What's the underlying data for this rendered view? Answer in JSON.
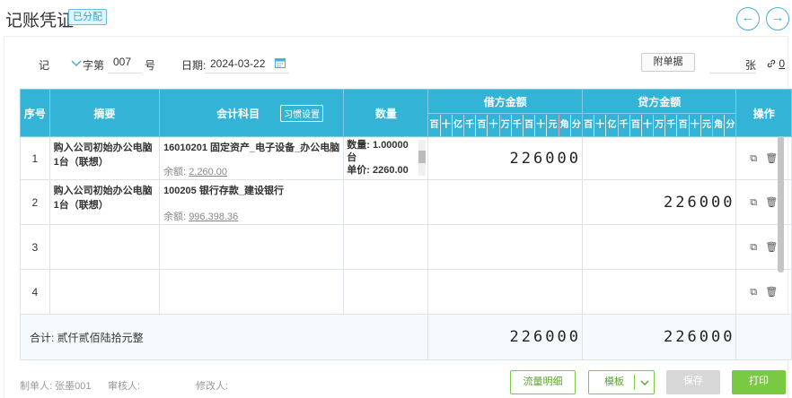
{
  "header": {
    "title": "记账凭证",
    "status_badge": "已分配",
    "prev_icon": "←",
    "next_icon": "→"
  },
  "meta": {
    "voucher_type": "记",
    "word_label": "字第",
    "number": "007",
    "number_suffix": "号",
    "date_label": "日期:",
    "date_value": "2024-03-22",
    "attach_button": "附单据",
    "sheets_label": "张",
    "attach_count": "0"
  },
  "table": {
    "headers": {
      "seq": "序号",
      "summary": "摘要",
      "account": "会计科目",
      "habit_button": "习惯设置",
      "qty": "数量",
      "debit": "借方金额",
      "credit": "贷方金额",
      "ops": "操作"
    },
    "digit_units": [
      "百",
      "十",
      "亿",
      "千",
      "百",
      "十",
      "万",
      "千",
      "百",
      "十",
      "元",
      "角",
      "分"
    ],
    "rows": [
      {
        "seq": "1",
        "summary": "购入公司初始办公电脑1台（联想）",
        "account": "16010201 固定资产_电子设备_办公电脑",
        "balance_label": "余额:",
        "balance": "2,260.00",
        "qty_line1": "数量: 1.00000",
        "qty_line2": "台",
        "qty_line3": "单价: 2260.00",
        "debit": "226000",
        "credit": ""
      },
      {
        "seq": "2",
        "summary": "购入公司初始办公电脑1台（联想）",
        "account": "100205 银行存款_建设银行",
        "balance_label": "余额:",
        "balance": "996,398.36",
        "qty_line1": "",
        "qty_line2": "",
        "qty_line3": "",
        "debit": "",
        "credit": "226000"
      },
      {
        "seq": "3",
        "summary": "",
        "account": "",
        "balance_label": "",
        "balance": "",
        "qty_line1": "",
        "qty_line2": "",
        "qty_line3": "",
        "debit": "",
        "credit": ""
      },
      {
        "seq": "4",
        "summary": "",
        "account": "",
        "balance_label": "",
        "balance": "",
        "qty_line1": "",
        "qty_line2": "",
        "qty_line3": "",
        "debit": "",
        "credit": ""
      }
    ],
    "total_label": "合计: 贰仟贰佰陆拾元整",
    "total_debit": "226000",
    "total_credit": "226000"
  },
  "footer": {
    "maker": "制单人: 张墨001",
    "auditor": "审核人:",
    "modifier": "修改人:",
    "flow_button": "流量明细",
    "template_button": "模板",
    "save_button": "保存",
    "print_button": "打印"
  },
  "colors": {
    "header_bg": "#33b3d6",
    "accent": "#4aaed8",
    "print_bg": "#7ac943",
    "red_rule": "#ee7f7f"
  }
}
